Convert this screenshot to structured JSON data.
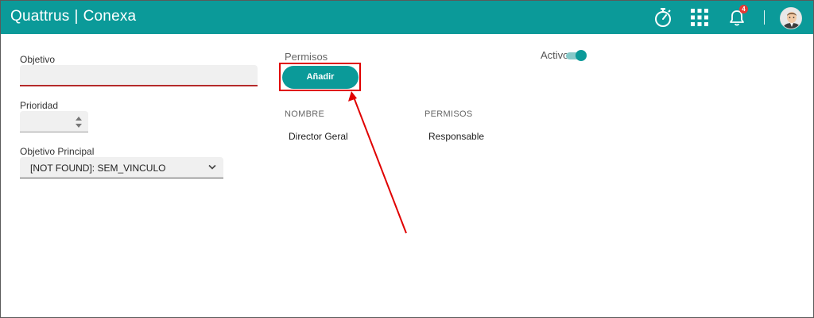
{
  "app": {
    "brand_left": "Quattrus",
    "brand_sep": "|",
    "brand_right": "Conexa",
    "notification_count": "4"
  },
  "icons": {
    "timer": "stopwatch-icon",
    "apps": "apps-grid-icon",
    "bell": "bell-icon",
    "avatar": "user-avatar"
  },
  "form": {
    "objetivo_label": "Objetivo",
    "objetivo_value": "",
    "prioridad_label": "Prioridad",
    "prioridad_value": "",
    "principal_label": "Objetivo Principal",
    "principal_value": "[NOT FOUND]: SEM_VINCULO"
  },
  "permisos": {
    "title": "Permisos",
    "add_label": "Añadir",
    "col_nombre": "NOMBRE",
    "col_permisos": "PERMISOS",
    "rows": [
      {
        "nombre": "Director Geral",
        "permiso": "Responsable"
      }
    ]
  },
  "status": {
    "active_label": "Activo",
    "active_on": true
  },
  "colors": {
    "primary": "#0b9a99",
    "error_underline": "#b52a2a",
    "highlight": "#e00000"
  }
}
